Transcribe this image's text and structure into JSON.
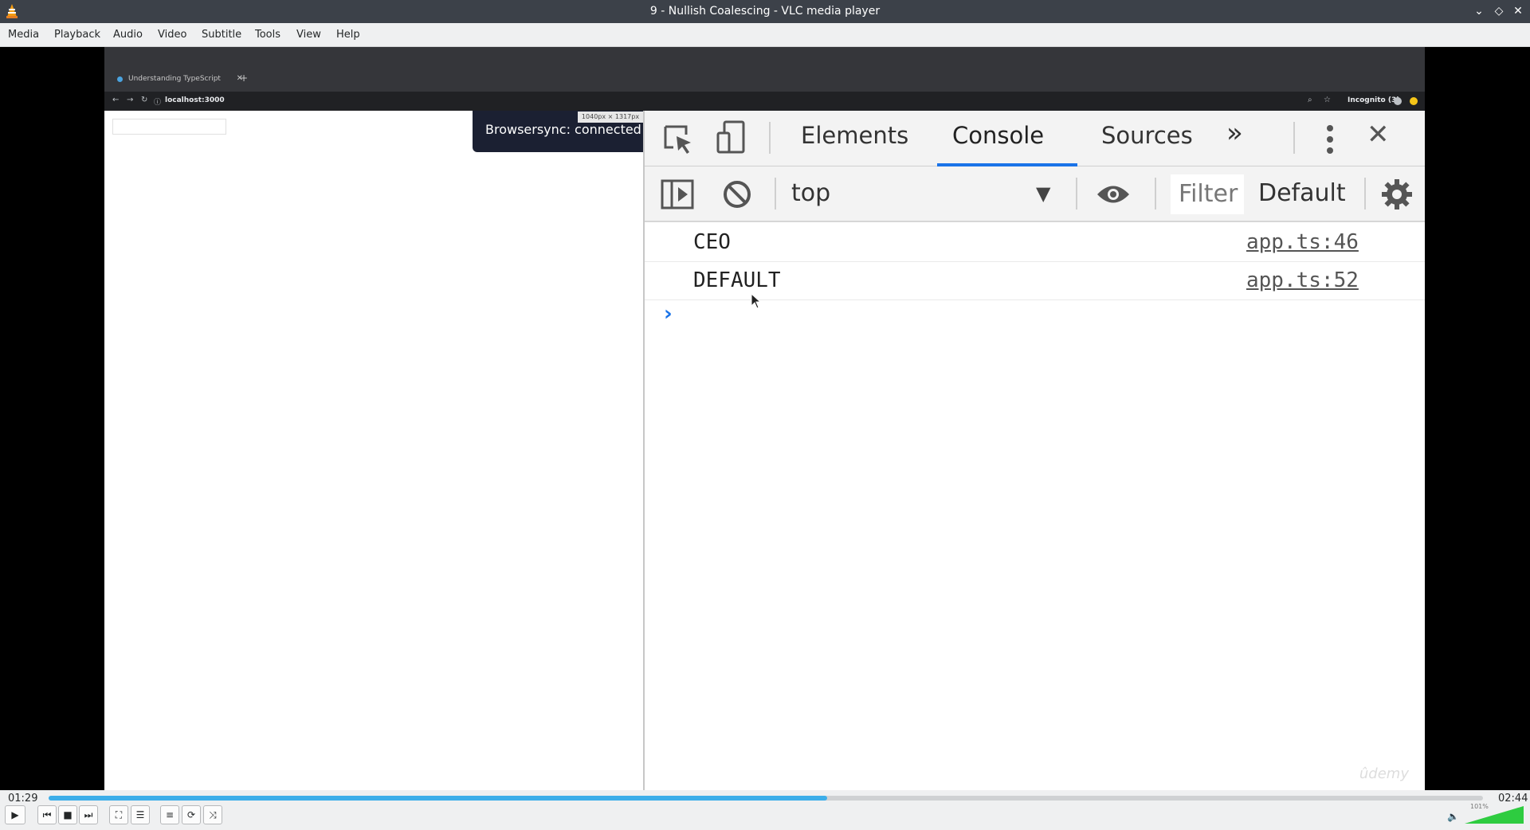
{
  "window": {
    "title": "9 - Nullish Coalescing - VLC media player"
  },
  "menu": [
    "Media",
    "Playback",
    "Audio",
    "Video",
    "Subtitle",
    "Tools",
    "View",
    "Help"
  ],
  "browser": {
    "tab_title": "Understanding TypeScript",
    "url": "localhost:3000",
    "incognito": "Incognito (3)",
    "size_tip": "1040px × 1317px",
    "browsersync": "Browsersync: connected"
  },
  "devtools": {
    "tabs": [
      "Elements",
      "Console",
      "Sources"
    ],
    "active_tab": "Console",
    "context": "top",
    "filter_placeholder": "Filter",
    "levels": "Default",
    "logs": [
      {
        "message": "CEO",
        "source": "app.ts:46"
      },
      {
        "message": "DEFAULT",
        "source": "app.ts:52"
      }
    ],
    "watermark": "ûdemy"
  },
  "player": {
    "elapsed": "01:29",
    "total": "02:44",
    "progress_fraction": 0.543,
    "volume": "101%",
    "volume_fraction": 1.0
  },
  "colors": {
    "accent": "#3daee9",
    "devtools_blue": "#1a73e8"
  }
}
